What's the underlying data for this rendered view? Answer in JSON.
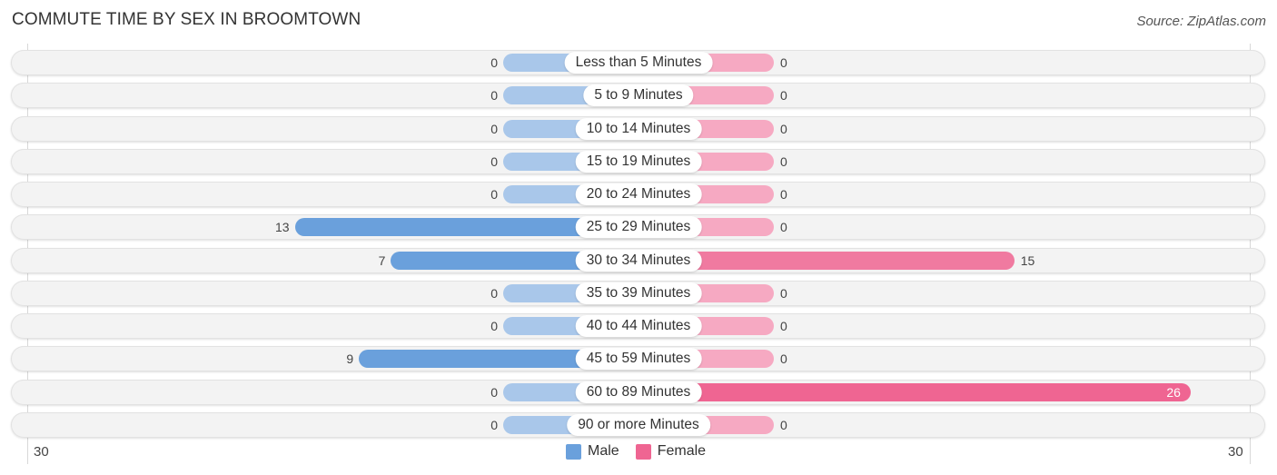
{
  "title": "COMMUTE TIME BY SEX IN BROOMTOWN",
  "source": "Source: ZipAtlas.com",
  "colors": {
    "male": "#6aa0dc",
    "female": "#ef6592"
  },
  "chart_data": {
    "type": "bar",
    "orientation": "horizontal-diverging",
    "title": "COMMUTE TIME BY SEX IN BROOMTOWN",
    "categories": [
      "Less than 5 Minutes",
      "5 to 9 Minutes",
      "10 to 14 Minutes",
      "15 to 19 Minutes",
      "20 to 24 Minutes",
      "25 to 29 Minutes",
      "30 to 34 Minutes",
      "35 to 39 Minutes",
      "40 to 44 Minutes",
      "45 to 59 Minutes",
      "60 to 89 Minutes",
      "90 or more Minutes"
    ],
    "series": [
      {
        "name": "Male",
        "values": [
          0,
          0,
          0,
          0,
          0,
          13,
          7,
          0,
          0,
          9,
          0,
          0
        ]
      },
      {
        "name": "Female",
        "values": [
          0,
          0,
          0,
          0,
          0,
          0,
          15,
          0,
          0,
          0,
          26,
          0
        ]
      }
    ],
    "axis": {
      "left_label": "30",
      "right_label": "30",
      "range": [
        -30,
        30
      ]
    },
    "legend": {
      "position": "bottom-center",
      "entries": [
        "Male",
        "Female"
      ]
    },
    "grid": false
  }
}
